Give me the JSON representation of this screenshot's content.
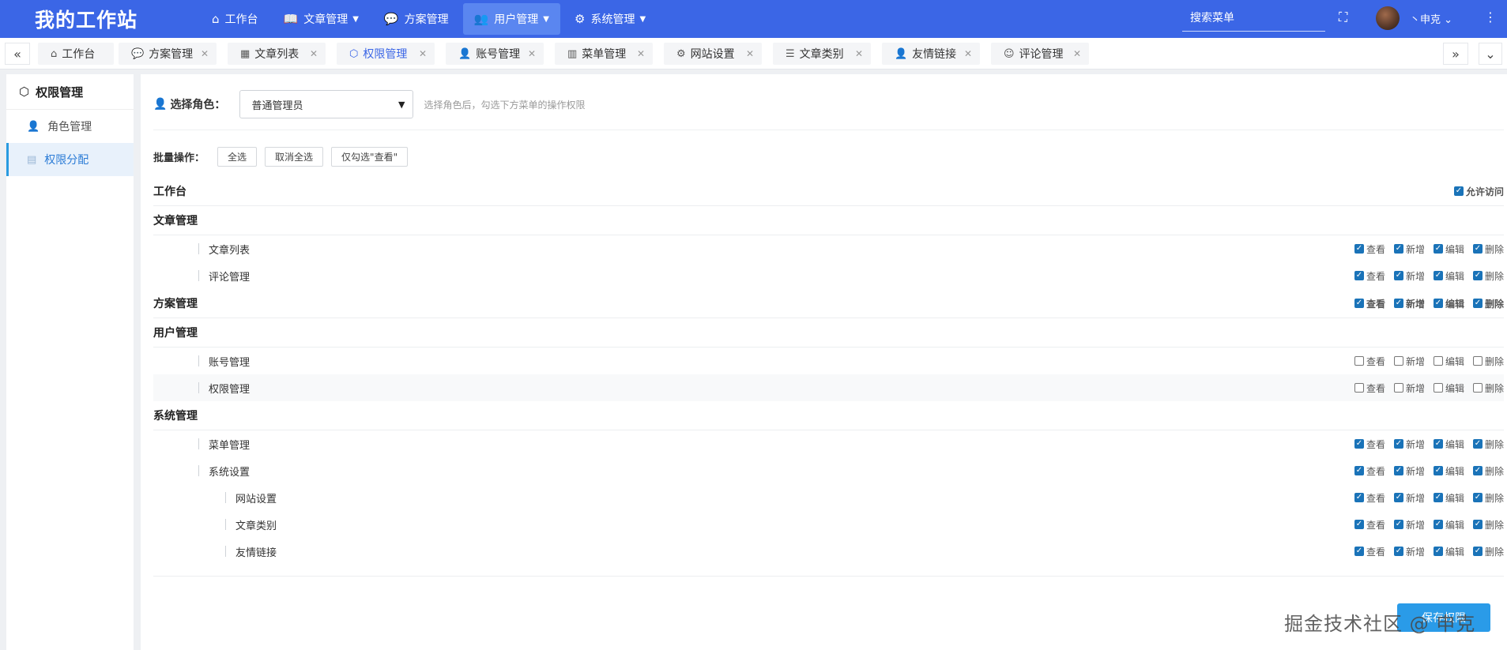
{
  "brand": {
    "title": "我的工作站"
  },
  "topnav": [
    {
      "label": "工作台",
      "icon": "home-icon",
      "glyph": "⌂",
      "dropdown": false,
      "active": false
    },
    {
      "label": "文章管理",
      "icon": "book-icon",
      "glyph": "📖",
      "dropdown": true,
      "active": false
    },
    {
      "label": "方案管理",
      "icon": "chat-icon",
      "glyph": "💬",
      "dropdown": false,
      "active": false
    },
    {
      "label": "用户管理",
      "icon": "users-icon",
      "glyph": "👥",
      "dropdown": true,
      "active": true
    },
    {
      "label": "系统管理",
      "icon": "gear-icon",
      "glyph": "⚙",
      "dropdown": true,
      "active": false
    }
  ],
  "header": {
    "search_placeholder": "搜索菜单",
    "username": "丶申克"
  },
  "tabs": [
    {
      "label": "工作台",
      "icon": "home-icon",
      "glyph": "⌂",
      "closable": false,
      "active": false
    },
    {
      "label": "方案管理",
      "icon": "chat-icon",
      "glyph": "💬",
      "closable": true,
      "active": false
    },
    {
      "label": "文章列表",
      "icon": "table-icon",
      "glyph": "▦",
      "closable": true,
      "active": false
    },
    {
      "label": "权限管理",
      "icon": "cube-icon",
      "glyph": "⬡",
      "closable": true,
      "active": true
    },
    {
      "label": "账号管理",
      "icon": "user-icon",
      "glyph": "👤",
      "closable": true,
      "active": false
    },
    {
      "label": "菜单管理",
      "icon": "grid-icon",
      "glyph": "▥",
      "closable": true,
      "active": false
    },
    {
      "label": "网站设置",
      "icon": "gear-icon",
      "glyph": "⚙",
      "closable": true,
      "active": false
    },
    {
      "label": "文章类别",
      "icon": "list-icon",
      "glyph": "☰",
      "closable": true,
      "active": false
    },
    {
      "label": "友情链接",
      "icon": "user-icon",
      "glyph": "👤",
      "closable": true,
      "active": false
    },
    {
      "label": "评论管理",
      "icon": "comment-icon",
      "glyph": "☺",
      "closable": true,
      "active": false
    }
  ],
  "sidebar": {
    "title": "权限管理",
    "items": [
      {
        "label": "角色管理",
        "icon": "user-icon",
        "active": false
      },
      {
        "label": "权限分配",
        "icon": "document-icon",
        "active": true
      }
    ]
  },
  "role": {
    "label": "选择角色：",
    "selected": "普通管理员",
    "hint": "选择角色后，勾选下方菜单的操作权限"
  },
  "batch": {
    "label": "批量操作：",
    "buttons": [
      "全选",
      "取消全选",
      "仅勾选\"查看\""
    ]
  },
  "permission_labels": [
    "查看",
    "新增",
    "编辑",
    "删除"
  ],
  "allow_label": "允许访问",
  "permissions": [
    {
      "kind": "group",
      "name": "工作台",
      "allow": true
    },
    {
      "kind": "group",
      "name": "文章管理"
    },
    {
      "kind": "item",
      "level": 1,
      "name": "文章列表",
      "checks": [
        true,
        true,
        true,
        true
      ]
    },
    {
      "kind": "item",
      "level": 1,
      "name": "评论管理",
      "checks": [
        true,
        true,
        true,
        true
      ]
    },
    {
      "kind": "group",
      "name": "方案管理",
      "checks": [
        true,
        true,
        true,
        true
      ]
    },
    {
      "kind": "group",
      "name": "用户管理"
    },
    {
      "kind": "item",
      "level": 1,
      "name": "账号管理",
      "checks": [
        false,
        false,
        false,
        false
      ]
    },
    {
      "kind": "item",
      "level": 1,
      "name": "权限管理",
      "checks": [
        false,
        false,
        false,
        false
      ],
      "highlight": true
    },
    {
      "kind": "group",
      "name": "系统管理"
    },
    {
      "kind": "item",
      "level": 1,
      "name": "菜单管理",
      "checks": [
        true,
        true,
        true,
        true
      ]
    },
    {
      "kind": "item",
      "level": 1,
      "name": "系统设置",
      "checks": [
        true,
        true,
        true,
        true
      ]
    },
    {
      "kind": "item",
      "level": 2,
      "name": "网站设置",
      "checks": [
        true,
        true,
        true,
        true
      ]
    },
    {
      "kind": "item",
      "level": 2,
      "name": "文章类别",
      "checks": [
        true,
        true,
        true,
        true
      ]
    },
    {
      "kind": "item",
      "level": 2,
      "name": "友情链接",
      "checks": [
        true,
        true,
        true,
        true
      ]
    }
  ],
  "save": {
    "label": "保存权限"
  },
  "watermark": "掘金技术社区 @ 申克",
  "colors": {
    "primary": "#3b66e6",
    "checkbox": "#1a73b8",
    "save": "#2a9be8"
  }
}
